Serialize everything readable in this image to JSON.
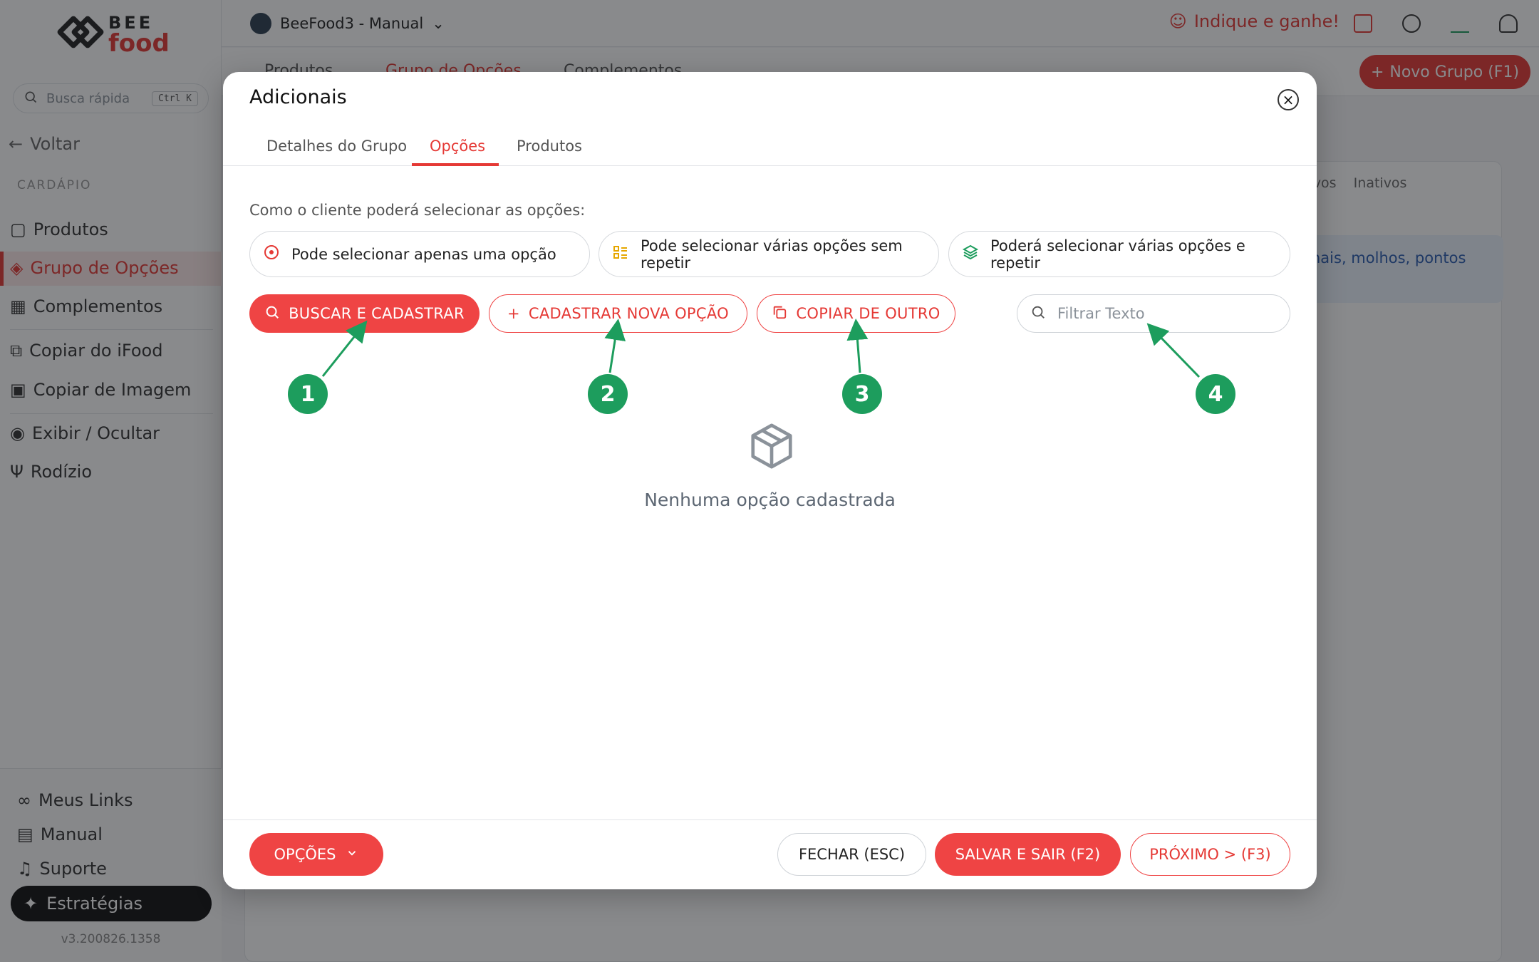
{
  "app": {
    "logo": {
      "line1": "BEE",
      "line2": "food"
    },
    "store_name": "BeeFood3 - Manual",
    "refer_label": "Indique e ganhe!",
    "search": {
      "placeholder": "Busca rápida",
      "shortcut": "Ctrl K"
    },
    "back_label": "Voltar",
    "section_label": "CARDÁPIO",
    "sidebar": {
      "items": [
        {
          "label": "Produtos",
          "icon": "box-icon"
        },
        {
          "label": "Grupo de Opções",
          "icon": "layers-icon"
        },
        {
          "label": "Complementos",
          "icon": "grid-icon"
        },
        {
          "label": "Copiar do iFood",
          "icon": "copy-icon"
        },
        {
          "label": "Copiar de Imagem",
          "icon": "image-icon"
        },
        {
          "label": "Exibir / Ocultar",
          "icon": "eye-icon"
        },
        {
          "label": "Rodízio",
          "icon": "utensils-icon"
        }
      ],
      "bottom": [
        {
          "label": "Meus Links",
          "icon": "link-icon"
        },
        {
          "label": "Manual",
          "icon": "book-icon"
        },
        {
          "label": "Suporte",
          "icon": "headset-icon"
        }
      ],
      "strategies_label": "Estratégias",
      "version": "v3.200826.1358"
    },
    "tabs": [
      "Produtos",
      "Grupo de Opções",
      "Complementos"
    ],
    "new_group_label": "Novo Grupo (F1)",
    "background": {
      "filter_labels": [
        "tivos",
        "Inativos"
      ],
      "alert_text": "nais, molhos, pontos"
    }
  },
  "modal": {
    "title": "Adicionais",
    "tabs": [
      "Detalhes do Grupo",
      "Opções",
      "Produtos"
    ],
    "question": "Como o cliente poderá selecionar as opções:",
    "choices": [
      "Pode selecionar apenas uma opção",
      "Pode selecionar várias opções sem repetir",
      "Poderá selecionar várias opções e repetir"
    ],
    "actions": {
      "search_register": "BUSCAR E CADASTRAR",
      "new_option": "CADASTRAR NOVA OPÇÃO",
      "copy_other": "COPIAR DE OUTRO"
    },
    "filter_placeholder": "Filtrar Texto",
    "markers": [
      "1",
      "2",
      "3",
      "4"
    ],
    "empty_text": "Nenhuma opção cadastrada",
    "footer": {
      "options_label": "OPÇÕES",
      "close_label": "FECHAR (ESC)",
      "save_label": "SALVAR E SAIR (F2)",
      "next_label": "PRÓXIMO > (F3)"
    }
  },
  "colors": {
    "accent": "#ef4444",
    "annotation": "#1d9d5d",
    "overlay": "rgba(20,22,26,0.5)"
  }
}
